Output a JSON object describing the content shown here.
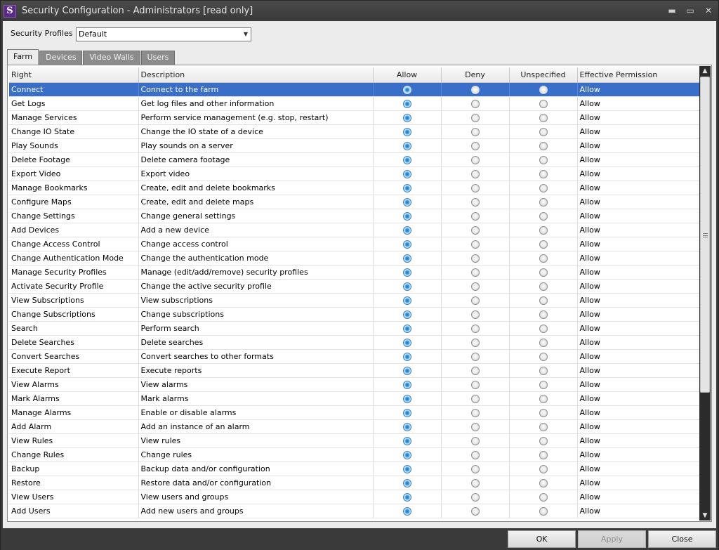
{
  "window": {
    "title": "Security Configuration - Administrators [read only]",
    "logo_letter": "S",
    "controls": {
      "minimize": "▬",
      "maximize": "▭",
      "close": "✕"
    }
  },
  "profile": {
    "label": "Security Profiles",
    "selected": "Default"
  },
  "tabs": [
    {
      "label": "Farm",
      "active": true
    },
    {
      "label": "Devices",
      "active": false
    },
    {
      "label": "Video Walls",
      "active": false
    },
    {
      "label": "Users",
      "active": false
    }
  ],
  "grid": {
    "columns": [
      "Right",
      "Description",
      "Allow",
      "Deny",
      "Unspecified",
      "Effective Permission"
    ],
    "rows": [
      {
        "right": "Connect",
        "description": "Connect to the farm",
        "value": "allow",
        "effective": "Allow",
        "selected": true
      },
      {
        "right": "Get Logs",
        "description": "Get log files and other information",
        "value": "allow",
        "effective": "Allow"
      },
      {
        "right": "Manage Services",
        "description": "Perform service management (e.g. stop, restart)",
        "value": "allow",
        "effective": "Allow"
      },
      {
        "right": "Change IO State",
        "description": "Change the IO state of a device",
        "value": "allow",
        "effective": "Allow"
      },
      {
        "right": "Play Sounds",
        "description": "Play sounds on a server",
        "value": "allow",
        "effective": "Allow"
      },
      {
        "right": "Delete Footage",
        "description": "Delete camera footage",
        "value": "allow",
        "effective": "Allow"
      },
      {
        "right": "Export Video",
        "description": "Export video",
        "value": "allow",
        "effective": "Allow"
      },
      {
        "right": "Manage Bookmarks",
        "description": "Create, edit and delete bookmarks",
        "value": "allow",
        "effective": "Allow"
      },
      {
        "right": "Configure Maps",
        "description": "Create, edit and delete maps",
        "value": "allow",
        "effective": "Allow"
      },
      {
        "right": "Change Settings",
        "description": "Change general settings",
        "value": "allow",
        "effective": "Allow"
      },
      {
        "right": "Add Devices",
        "description": "Add a new device",
        "value": "allow",
        "effective": "Allow"
      },
      {
        "right": "Change Access Control",
        "description": "Change access control",
        "value": "allow",
        "effective": "Allow"
      },
      {
        "right": "Change Authentication Mode",
        "description": "Change the authentication mode",
        "value": "allow",
        "effective": "Allow"
      },
      {
        "right": "Manage Security Profiles",
        "description": "Manage (edit/add/remove) security profiles",
        "value": "allow",
        "effective": "Allow"
      },
      {
        "right": "Activate Security Profile",
        "description": "Change the active security profile",
        "value": "allow",
        "effective": "Allow"
      },
      {
        "right": "View Subscriptions",
        "description": "View subscriptions",
        "value": "allow",
        "effective": "Allow"
      },
      {
        "right": "Change Subscriptions",
        "description": "Change subscriptions",
        "value": "allow",
        "effective": "Allow"
      },
      {
        "right": "Search",
        "description": "Perform search",
        "value": "allow",
        "effective": "Allow"
      },
      {
        "right": "Delete Searches",
        "description": "Delete searches",
        "value": "allow",
        "effective": "Allow"
      },
      {
        "right": "Convert Searches",
        "description": "Convert searches to other formats",
        "value": "allow",
        "effective": "Allow"
      },
      {
        "right": "Execute Report",
        "description": "Execute reports",
        "value": "allow",
        "effective": "Allow"
      },
      {
        "right": "View Alarms",
        "description": "View alarms",
        "value": "allow",
        "effective": "Allow"
      },
      {
        "right": "Mark Alarms",
        "description": "Mark alarms",
        "value": "allow",
        "effective": "Allow"
      },
      {
        "right": "Manage Alarms",
        "description": "Enable or disable alarms",
        "value": "allow",
        "effective": "Allow"
      },
      {
        "right": "Add Alarm",
        "description": "Add an instance of an alarm",
        "value": "allow",
        "effective": "Allow"
      },
      {
        "right": "View Rules",
        "description": "View rules",
        "value": "allow",
        "effective": "Allow"
      },
      {
        "right": "Change Rules",
        "description": "Change rules",
        "value": "allow",
        "effective": "Allow"
      },
      {
        "right": "Backup",
        "description": "Backup data and/or configuration",
        "value": "allow",
        "effective": "Allow"
      },
      {
        "right": "Restore",
        "description": "Restore data and/or configuration",
        "value": "allow",
        "effective": "Allow"
      },
      {
        "right": "View Users",
        "description": "View users and groups",
        "value": "allow",
        "effective": "Allow"
      },
      {
        "right": "Add Users",
        "description": "Add new users and groups",
        "value": "allow",
        "effective": "Allow"
      }
    ]
  },
  "scrollbar": {
    "up_glyph": "▲",
    "down_glyph": "▼"
  },
  "buttons": {
    "ok": {
      "label": "OK",
      "enabled": true
    },
    "apply": {
      "label": "Apply",
      "enabled": false
    },
    "close": {
      "label": "Close",
      "enabled": true
    }
  },
  "colors": {
    "selection": "#3a6fc9",
    "title_bar": "#3a3a3a",
    "client": "#ececec"
  }
}
